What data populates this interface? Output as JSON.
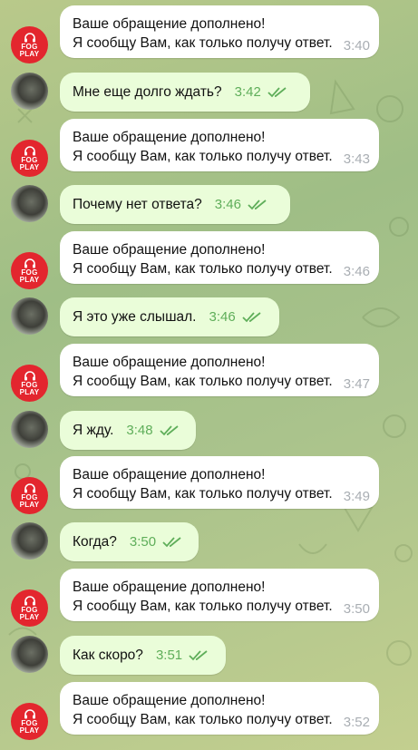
{
  "bot_avatar": {
    "line1": "FOG",
    "line2": "PLAY"
  },
  "messages": [
    {
      "from": "bot",
      "line1": "Ваше обращение дополнено!",
      "line2": "Я сообщу Вам, как только получу ответ.",
      "time": "3:40"
    },
    {
      "from": "user",
      "text": "Мне еще долго ждать?",
      "time": "3:42"
    },
    {
      "from": "bot",
      "line1": "Ваше обращение дополнено!",
      "line2": "Я сообщу Вам, как только получу ответ.",
      "time": "3:43"
    },
    {
      "from": "user",
      "text": "Почему нет ответа?",
      "time": "3:46"
    },
    {
      "from": "bot",
      "line1": "Ваше обращение дополнено!",
      "line2": "Я сообщу Вам, как только получу ответ.",
      "time": "3:46"
    },
    {
      "from": "user",
      "text": "Я это уже слышал.",
      "time": "3:46"
    },
    {
      "from": "bot",
      "line1": "Ваше обращение дополнено!",
      "line2": "Я сообщу Вам, как только получу ответ.",
      "time": "3:47"
    },
    {
      "from": "user",
      "text": "Я жду.",
      "time": "3:48"
    },
    {
      "from": "bot",
      "line1": "Ваше обращение дополнено!",
      "line2": "Я сообщу Вам, как только получу ответ.",
      "time": "3:49"
    },
    {
      "from": "user",
      "text": "Когда?",
      "time": "3:50"
    },
    {
      "from": "bot",
      "line1": "Ваше обращение дополнено!",
      "line2": "Я сообщу Вам, как только получу ответ.",
      "time": "3:50"
    },
    {
      "from": "user",
      "text": "Как скоро?",
      "time": "3:51"
    },
    {
      "from": "bot",
      "line1": "Ваше обращение дополнено!",
      "line2": "Я сообщу Вам, как только получу ответ.",
      "time": "3:52"
    }
  ],
  "colors": {
    "bot_bubble": "#ffffff",
    "user_bubble": "#eafdd9",
    "read_ticks": "#5fae5a",
    "bot_avatar_bg": "#e3262e"
  }
}
